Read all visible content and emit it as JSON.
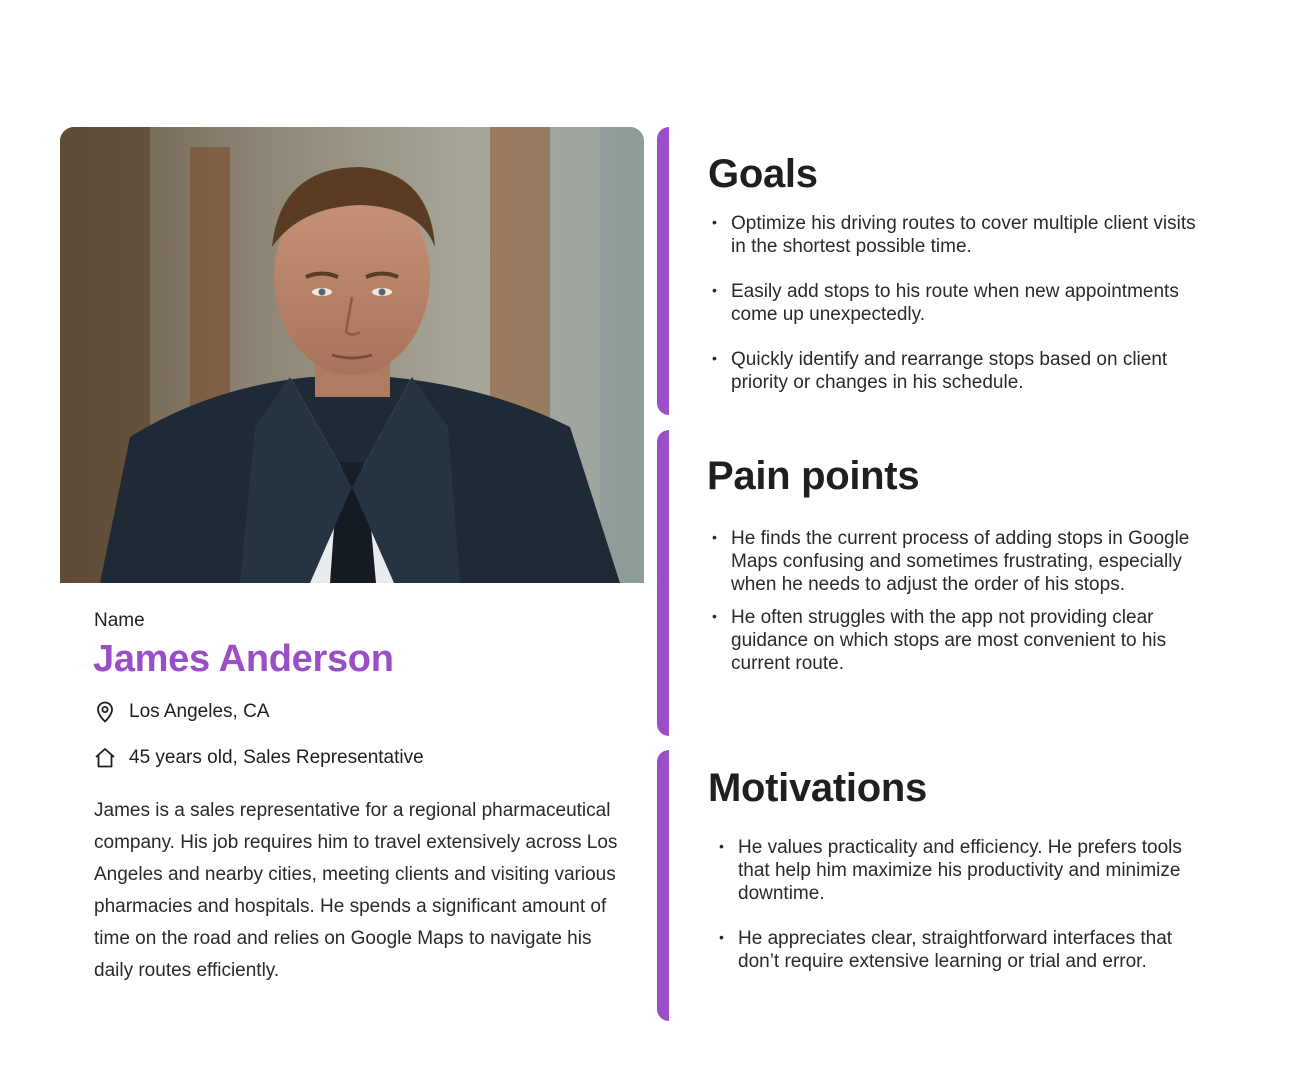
{
  "profile": {
    "photo": "portrait-photo",
    "name_caption": "Name",
    "name": "James Anderson",
    "location": "Los Angeles, CA",
    "location_icon": "location-pin-icon",
    "details": "45 years old, Sales Representative",
    "details_icon": "home-icon",
    "bio": "James is a sales representative for a regional pharmaceutical company. His job requires him to travel extensively across Los Angeles and nearby cities, meeting clients and visiting various pharmacies and hospitals. He spends a significant amount of time on the road and relies on Google Maps to navigate his daily routes efficiently."
  },
  "goals": {
    "title": "Goals",
    "items": [
      "Optimize his driving routes to cover multiple client visits in the shortest possible time.",
      "Easily add stops to his route when new appointments come up unexpectedly.",
      "Quickly identify and rearrange stops based on client priority or changes in his schedule."
    ]
  },
  "pain_points": {
    "title": "Pain points",
    "items": [
      "He finds the current process of adding stops in Google Maps confusing and sometimes frustrating, especially when he needs to adjust the order of his stops.",
      "He often struggles with the app not providing clear guidance on which stops are most convenient to his current route."
    ]
  },
  "motivations": {
    "title": "Motivations",
    "items": [
      "He values practicality and efficiency. He prefers tools that help him maximize his productivity and minimize downtime.",
      "He appreciates clear, straightforward interfaces that don’t require extensive learning or trial and error."
    ]
  },
  "colors": {
    "accent": "#9a4fc6",
    "text": "#1f1f1f"
  }
}
